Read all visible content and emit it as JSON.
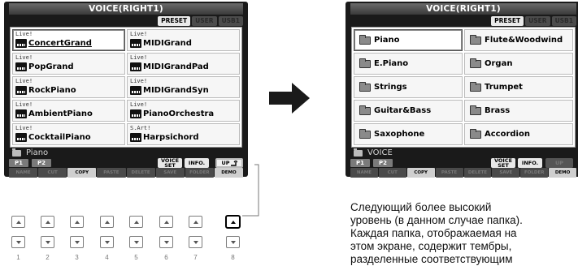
{
  "left_screen": {
    "title": "VOICE(RIGHT1)",
    "bank_tabs": [
      "PRESET",
      "USER",
      "USB1"
    ],
    "voices": [
      {
        "tag": "Live!",
        "name": "ConcertGrand",
        "selected": true
      },
      {
        "tag": "Live!",
        "name": "MIDIGrand"
      },
      {
        "tag": "Live!",
        "name": "PopGrand"
      },
      {
        "tag": "Live!",
        "name": "MIDIGrandPad"
      },
      {
        "tag": "Live!",
        "name": "RockPiano"
      },
      {
        "tag": "Live!",
        "name": "MIDIGrandSyn"
      },
      {
        "tag": "Live!",
        "name": "AmbientPiano"
      },
      {
        "tag": "Live!",
        "name": "PianoOrchestra"
      },
      {
        "tag": "Live!",
        "name": "CocktailPiano"
      },
      {
        "tag": "S.Art!",
        "name": "Harpsichord"
      }
    ],
    "path": "Piano",
    "pages": [
      "P1",
      "P2"
    ],
    "voice_set_label": "VOICE SET",
    "info_label": "INFO.",
    "up_label": "UP",
    "func_buttons": [
      "NAME",
      "CUT",
      "COPY",
      "PASTE",
      "DELETE",
      "SAVE",
      "FOLDER",
      "DEMO"
    ]
  },
  "right_screen": {
    "title": "VOICE(RIGHT1)",
    "bank_tabs": [
      "PRESET",
      "USER",
      "USB1"
    ],
    "folders": [
      {
        "name": "Piano",
        "selected": true
      },
      {
        "name": "Flute&Woodwind"
      },
      {
        "name": "E.Piano"
      },
      {
        "name": "Organ"
      },
      {
        "name": "Strings"
      },
      {
        "name": "Trumpet"
      },
      {
        "name": "Guitar&Bass"
      },
      {
        "name": "Brass"
      },
      {
        "name": "Saxophone"
      },
      {
        "name": "Accordion"
      }
    ],
    "path": "VOICE",
    "pages": [
      "P1",
      "P2"
    ],
    "voice_set_label": "VOICE SET",
    "info_label": "INFO.",
    "up_label": "UP",
    "func_buttons": [
      "NAME",
      "CUT",
      "COPY",
      "PASTE",
      "DELETE",
      "SAVE",
      "FOLDER",
      "DEMO"
    ]
  },
  "panel_buttons": {
    "numbers": [
      "1",
      "2",
      "3",
      "4",
      "5",
      "6",
      "7",
      "8"
    ],
    "highlighted_up": "8"
  },
  "caption": {
    "lines": [
      "Следующий более высокий",
      "уровень (в данном случае папка).",
      "Каждая папка, отображаемая на",
      "этом экране, содержит тембры,",
      "разделенные соответствующим"
    ]
  },
  "colors": {
    "screen_bg": "#1a1a1a",
    "title_bar": "#4a4a4a",
    "cell_bg": "#f6f6f6",
    "arrow": "#1a1a1a",
    "highlight": "#000000"
  },
  "icons": {
    "voice": "keyboard-icon",
    "folder": "folder-icon",
    "arrow": "arrow-right-icon",
    "up": "up-return-icon",
    "panel_up": "triangle-up-icon",
    "panel_down": "triangle-down-icon"
  }
}
